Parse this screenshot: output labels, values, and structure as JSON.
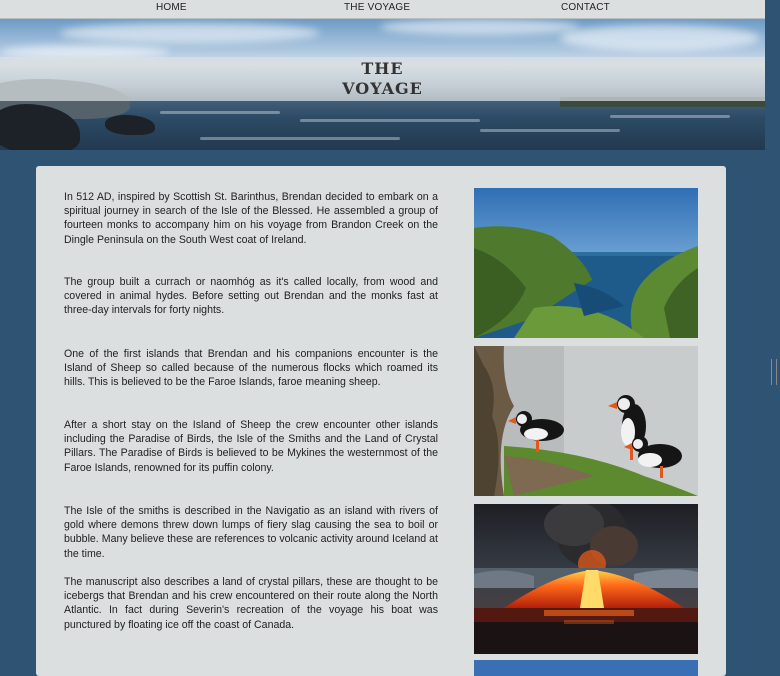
{
  "nav": {
    "home": "HOME",
    "voyage": "THE VOYAGE",
    "contact": "CONTACT"
  },
  "hero": {
    "title_line1": "THE",
    "title_line2": "VOYAGE"
  },
  "content": {
    "paragraphs": [
      "In 512 AD, inspired by Scottish St. Barinthus, Brendan decided to embark on a spiritual journey in search of the Isle of the Blessed. He assembled a group of fourteen monks to accompany him on his voyage from Brandon Creek on the Dingle Peninsula on the South West coat of Ireland.",
      "The group built a currach or naomhóg as it's called locally, from wood and covered in animal hydes. Before setting out Brendan and the monks fast at three-day intervals for forty nights.",
      "One of the first islands that Brendan and his companions encounter is the Island of Sheep so called because of the numerous flocks which roamed its hills. This is believed to be the Faroe Islands, faroe meaning sheep.",
      "After a short stay on the Island of Sheep the crew encounter other islands including the Paradise of Birds, the Isle of the Smiths and the Land of Crystal Pillars. The Paradise of Birds is believed to be Mykines the westernmost of the Faroe Islands, renowned for its puffin colony.",
      "The Isle of the smiths is described in the Navigatio as an island with rivers of gold where demons threw down lumps of fiery slag causing the sea to boil or bubble. Many believe these are references to volcanic activity around Iceland at the time.",
      "The manuscript also describes a land of crystal pillars, these are thought to be icebergs that Brendan and his crew encountered on their route along the North Atlantic. In fact during Severin's recreation of the voyage his boat was punctured by floating ice off the coast of Canada."
    ]
  },
  "colors": {
    "page_bg": "#2f5473",
    "card_bg": "#dcdfe0",
    "nav_bg": "#dcdfe0"
  }
}
